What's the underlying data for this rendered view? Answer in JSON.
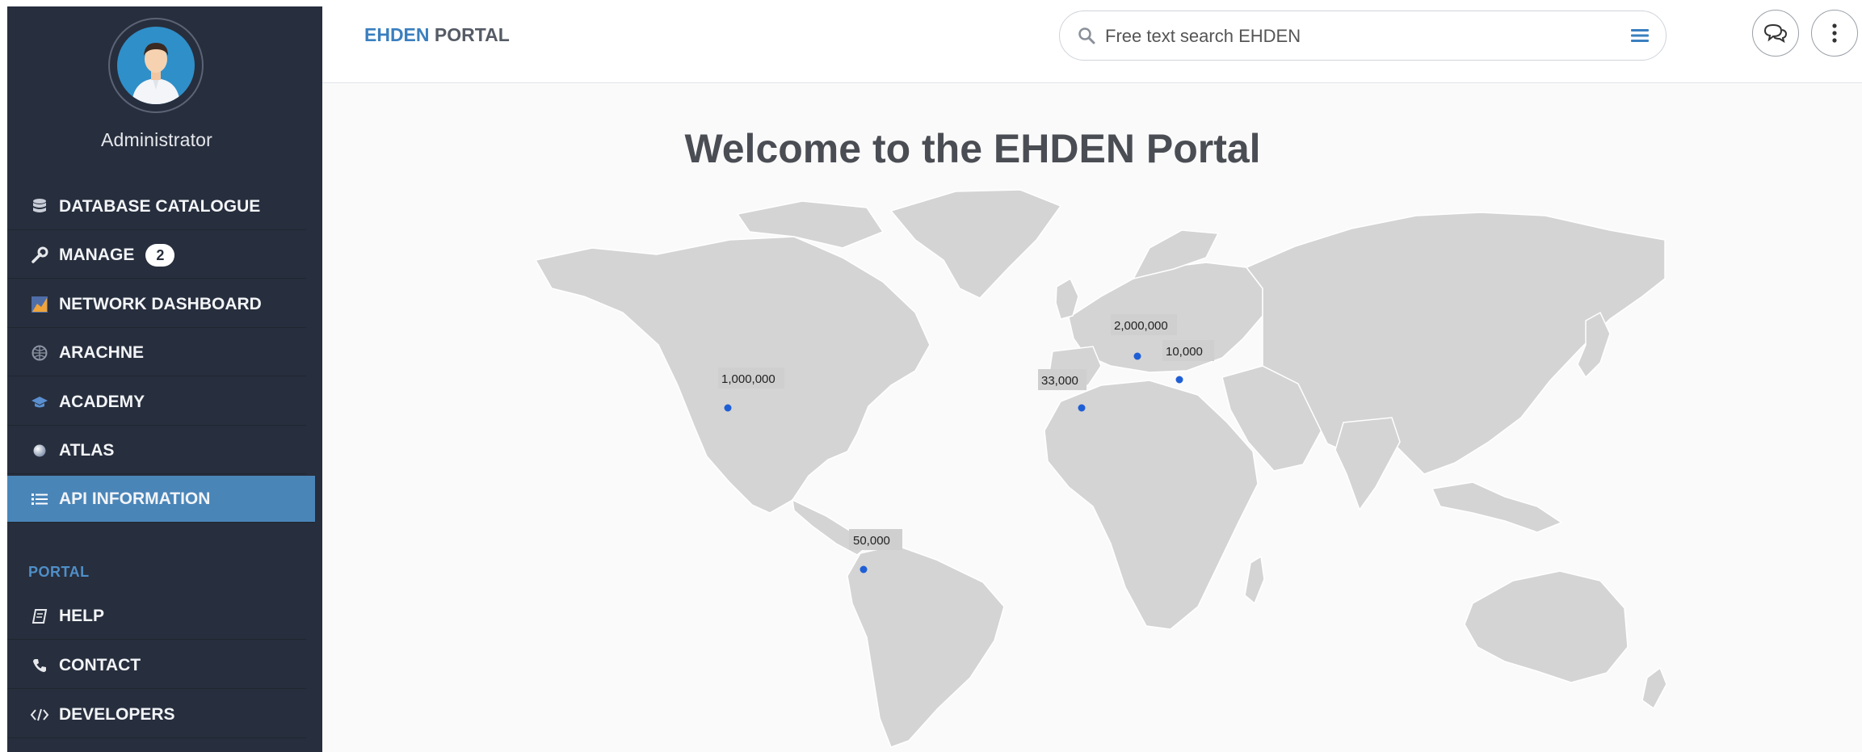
{
  "sidebar": {
    "user": {
      "name": "Administrator"
    },
    "items": [
      {
        "label": "DATABASE CATALOGUE",
        "icon": "database-icon"
      },
      {
        "label": "MANAGE",
        "icon": "wrench-icon",
        "badge": "2"
      },
      {
        "label": "NETWORK DASHBOARD",
        "icon": "chart-icon"
      },
      {
        "label": "ARACHNE",
        "icon": "globe-icon"
      },
      {
        "label": "ACADEMY",
        "icon": "graduation-cap-icon"
      },
      {
        "label": "ATLAS",
        "icon": "sphere-icon"
      },
      {
        "label": "API INFORMATION",
        "icon": "list-icon",
        "active": true
      }
    ],
    "section_label": "PORTAL",
    "portal_items": [
      {
        "label": "HELP",
        "icon": "book-icon"
      },
      {
        "label": "CONTACT",
        "icon": "phone-icon"
      },
      {
        "label": "DEVELOPERS",
        "icon": "code-icon"
      }
    ]
  },
  "header": {
    "brand_part1": "EHDEN",
    "brand_part2": "PORTAL",
    "search": {
      "placeholder": "Free text search EHDEN"
    },
    "buttons": [
      "chat-icon",
      "more-vertical-icon"
    ]
  },
  "main": {
    "title": "Welcome to the EHDEN Portal",
    "map_markers": [
      {
        "label": "1,000,000"
      },
      {
        "label": "2,000,000"
      },
      {
        "label": "10,000"
      },
      {
        "label": "33,000"
      },
      {
        "label": "50,000"
      }
    ]
  },
  "colors": {
    "sidebar_bg": "#272e3d",
    "active_item": "#4a85b8",
    "brand_blue": "#3a7fbf",
    "marker_dot": "#1f5fd6",
    "land": "#d4d4d4"
  }
}
